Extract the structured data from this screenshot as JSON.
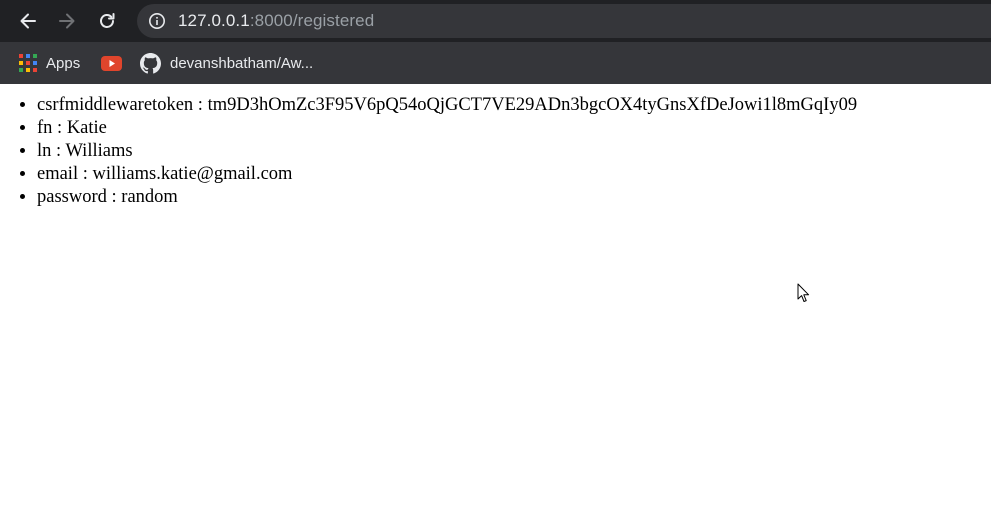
{
  "browser": {
    "url_host": "127.0.0.1",
    "url_rest": ":8000/registered",
    "bookmarks": [
      {
        "label": "Apps",
        "icon": "apps-grid-icon"
      },
      {
        "label": "",
        "icon": "youtube-icon"
      },
      {
        "label": "devanshbatham/Aw...",
        "icon": "github-icon"
      }
    ],
    "colors": {
      "toolbar": "#202124",
      "bookmarks_bar": "#35363a",
      "omnibox": "#35363a",
      "url_host": "#e8eaed",
      "url_rest": "#9aa0a6"
    }
  },
  "page": {
    "fields": [
      {
        "key": "csrfmiddlewaretoken",
        "sep": " : ",
        "value": "tm9D3hOmZc3F95V6pQ54oQjGCT7VE29ADn3bgcOX4tyGnsXfDeJowi1l8mGqIy09"
      },
      {
        "key": "fn",
        "sep": " : ",
        "value": "Katie"
      },
      {
        "key": "ln",
        "sep": " : ",
        "value": "Williams"
      },
      {
        "key": "email",
        "sep": " : ",
        "value": "williams.katie@gmail.com"
      },
      {
        "key": "password",
        "sep": " : ",
        "value": "random"
      }
    ]
  }
}
